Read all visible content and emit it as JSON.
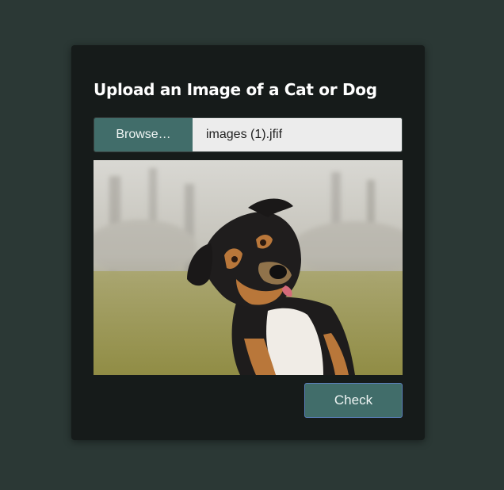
{
  "upload_card": {
    "title": "Upload an Image of a Cat or Dog",
    "browse_label": "Browse…",
    "file_name": "images (1).jfif",
    "preview_image": "dog-photo",
    "check_label": "Check"
  },
  "colors": {
    "page_background": "#2b3835",
    "card_background": "#161b1a",
    "button_teal": "#416d6a",
    "button_focus_border": "#5a7fb8",
    "file_field_background": "#ececec"
  }
}
